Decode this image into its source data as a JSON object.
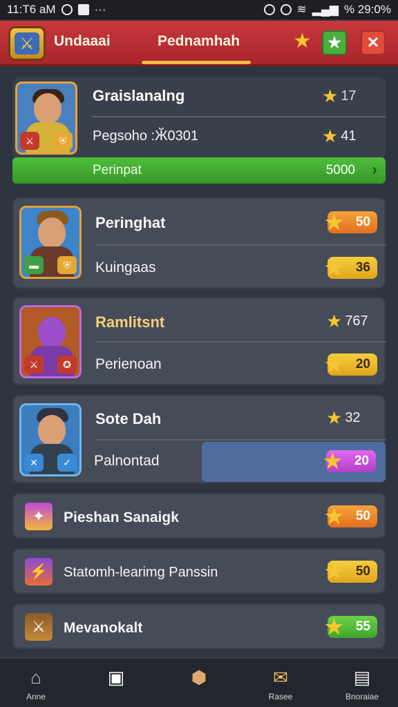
{
  "status": {
    "time": "11:T6 aM",
    "right": "%  29:0%"
  },
  "header": {
    "tabs": [
      {
        "label": "Undaaai"
      },
      {
        "label": "Pednamhah"
      }
    ],
    "star_icon": "star-icon",
    "action_icon": "star-badge-icon",
    "close_icon": "close-icon"
  },
  "featured": {
    "name": "Graislanalng",
    "name_score": "17",
    "sub": "Pegsoho :Ӂ0301",
    "sub_score": "41",
    "progress_label": "Perinpat",
    "progress_value": "5000"
  },
  "heroes": [
    {
      "name": "Peringhat",
      "name_score": "50",
      "sub": "Kuingaas",
      "sub_score": "36"
    },
    {
      "name": "Ramlitsnt",
      "name_score": "767",
      "sub": "Perienoan",
      "sub_score": "20"
    },
    {
      "name": "Sote Dah",
      "name_score": "32",
      "sub": "Palnontad",
      "sub_score": "20"
    }
  ],
  "items": [
    {
      "name": "Pieshan Sanaigk",
      "score": "50"
    },
    {
      "name": "Statomh-learimg Panssin",
      "score": "50"
    },
    {
      "name": "Mevanokalt",
      "score": "55"
    }
  ],
  "nav": [
    {
      "label": "Anne",
      "icon": "home-icon"
    },
    {
      "label": "",
      "icon": "card-icon"
    },
    {
      "label": "",
      "icon": "chest-icon"
    },
    {
      "label": "Rasee",
      "icon": "mail-icon"
    },
    {
      "label": "Bnoraiae",
      "icon": "profile-icon"
    }
  ],
  "colors": {
    "topbar": "#b52c31",
    "progress": "#44ad33",
    "background": "#2f3540"
  }
}
